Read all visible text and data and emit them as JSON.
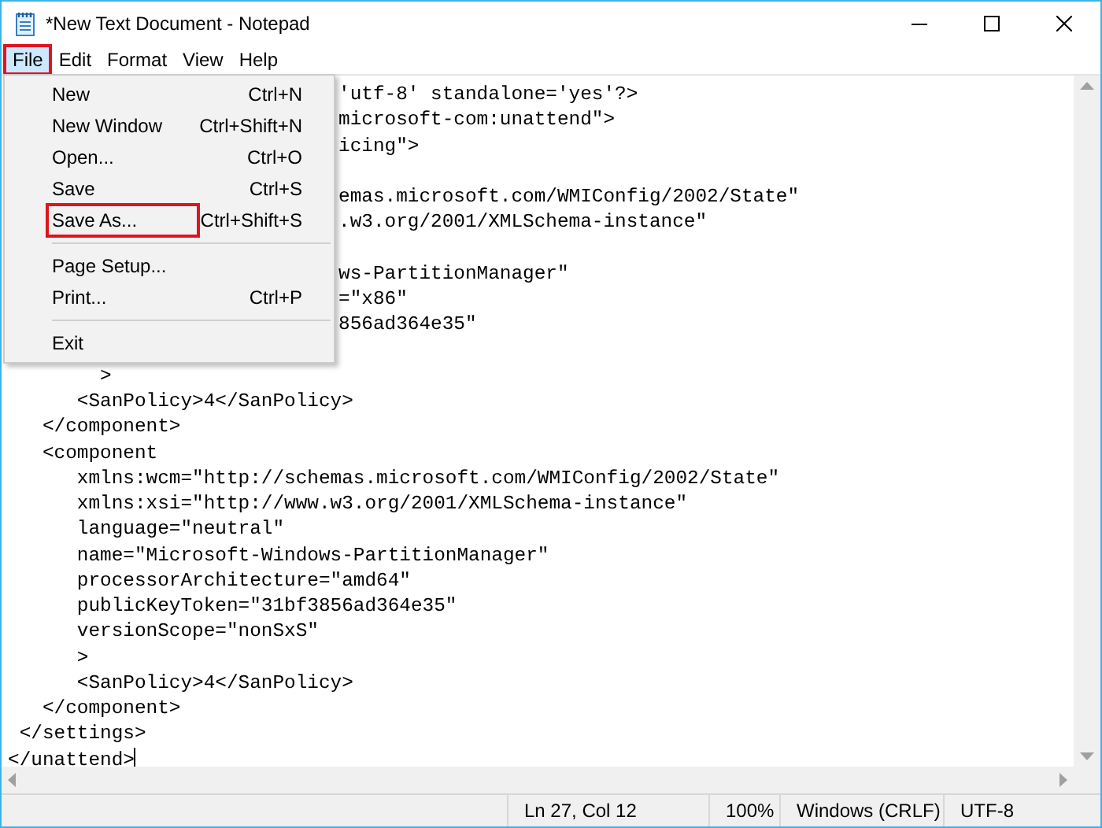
{
  "window": {
    "title": "*New Text Document - Notepad"
  },
  "menu_bar": [
    {
      "label": "File",
      "selected": true,
      "annotated": true
    },
    {
      "label": "Edit",
      "selected": false,
      "annotated": false
    },
    {
      "label": "Format",
      "selected": false,
      "annotated": false
    },
    {
      "label": "View",
      "selected": false,
      "annotated": false
    },
    {
      "label": "Help",
      "selected": false,
      "annotated": false
    }
  ],
  "file_menu": [
    {
      "kind": "item",
      "label": "New",
      "shortcut": "Ctrl+N",
      "annotated": false
    },
    {
      "kind": "item",
      "label": "New Window",
      "shortcut": "Ctrl+Shift+N",
      "annotated": false
    },
    {
      "kind": "item",
      "label": "Open...",
      "shortcut": "Ctrl+O",
      "annotated": false
    },
    {
      "kind": "item",
      "label": "Save",
      "shortcut": "Ctrl+S",
      "annotated": false
    },
    {
      "kind": "item",
      "label": "Save As...",
      "shortcut": "Ctrl+Shift+S",
      "annotated": true
    },
    {
      "kind": "separator"
    },
    {
      "kind": "item",
      "label": "Page Setup...",
      "annotated": false
    },
    {
      "kind": "item",
      "label": "Print...",
      "shortcut": "Ctrl+P",
      "annotated": false
    },
    {
      "kind": "separator"
    },
    {
      "kind": "item",
      "label": "Exit",
      "annotated": false
    }
  ],
  "editor": {
    "lines": [
      {
        "kind": "partial",
        "text": "'utf-8' standalone='yes'?>"
      },
      {
        "kind": "partial",
        "text": "microsoft-com:unattend\">"
      },
      {
        "kind": "partial",
        "text": "icing\">"
      },
      {
        "kind": "blank"
      },
      {
        "kind": "partial",
        "text": "emas.microsoft.com/WMIConfig/2002/State\""
      },
      {
        "kind": "partial",
        "text": ".w3.org/2001/XMLSchema-instance\""
      },
      {
        "kind": "blank"
      },
      {
        "kind": "partial",
        "text": "ws-PartitionManager\""
      },
      {
        "kind": "partial",
        "text": "=\"x86\""
      },
      {
        "kind": "partial",
        "text": "856ad364e35\""
      },
      {
        "kind": "blank"
      },
      {
        "kind": "full",
        "text": "        >"
      },
      {
        "kind": "full",
        "text": "      <SanPolicy>4</SanPolicy>"
      },
      {
        "kind": "full",
        "text": "   </component>"
      },
      {
        "kind": "full",
        "text": "   <component"
      },
      {
        "kind": "full",
        "text": "      xmlns:wcm=\"http://schemas.microsoft.com/WMIConfig/2002/State\""
      },
      {
        "kind": "full",
        "text": "      xmlns:xsi=\"http://www.w3.org/2001/XMLSchema-instance\""
      },
      {
        "kind": "full",
        "text": "      language=\"neutral\""
      },
      {
        "kind": "full",
        "text": "      name=\"Microsoft-Windows-PartitionManager\""
      },
      {
        "kind": "full",
        "text": "      processorArchitecture=\"amd64\""
      },
      {
        "kind": "full",
        "text": "      publicKeyToken=\"31bf3856ad364e35\""
      },
      {
        "kind": "full",
        "text": "      versionScope=\"nonSxS\""
      },
      {
        "kind": "full",
        "text": "      >"
      },
      {
        "kind": "full",
        "text": "      <SanPolicy>4</SanPolicy>"
      },
      {
        "kind": "full",
        "text": "   </component>"
      },
      {
        "kind": "full",
        "text": " </settings>"
      },
      {
        "kind": "full",
        "text": "</unattend>",
        "caret": true
      }
    ]
  },
  "status_bar": [
    "Ln 27, Col 12",
    "100%",
    "Windows (CRLF)",
    "UTF-8"
  ]
}
